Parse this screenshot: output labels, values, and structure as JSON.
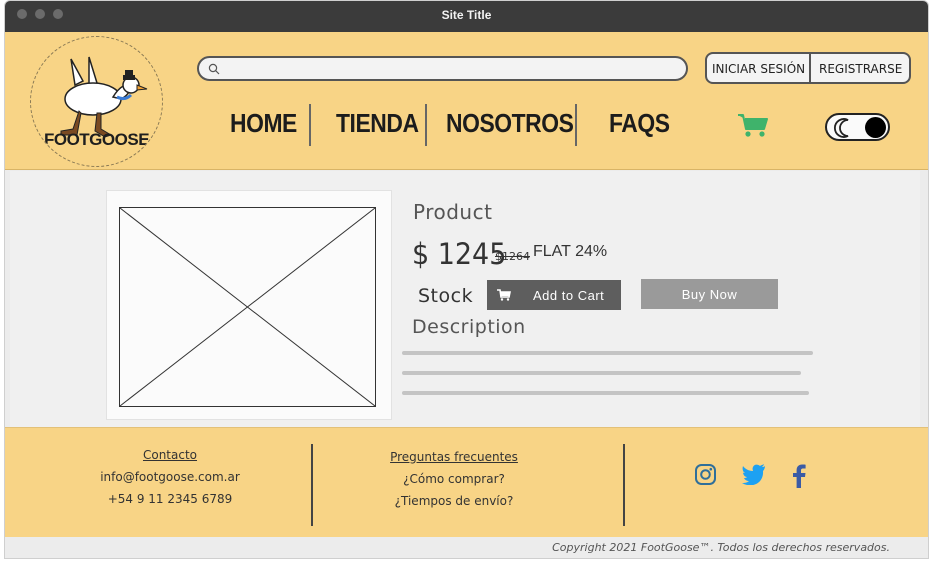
{
  "window": {
    "title": "Site Title"
  },
  "header": {
    "logo_text": "FOOTGOOSE",
    "search": {
      "placeholder": "",
      "value": ""
    },
    "auth": {
      "login_label": "INICIAR SESIÓN",
      "register_label": "REGISTRARSE"
    },
    "nav": [
      {
        "label": "HOME"
      },
      {
        "label": "TIENDA"
      },
      {
        "label": "NOSOTROS"
      },
      {
        "label": "FAQS"
      }
    ],
    "cart_icon": "shopping-cart-icon",
    "theme_toggle": {
      "icon": "moon-icon",
      "state": "dark"
    }
  },
  "product": {
    "title": "Product",
    "price": "$ 1245",
    "old_price": "$1264",
    "discount": "FLAT 24%",
    "stock_label": "Stock",
    "add_to_cart_label": "Add to Cart",
    "buy_now_label": "Buy Now",
    "description_label": "Description"
  },
  "footer": {
    "contact": {
      "heading": "Contacto",
      "email": "info@footgoose.com.ar",
      "phone": "+54 9 11 2345 6789"
    },
    "faq": {
      "heading": "Preguntas frecuentes",
      "items": [
        "¿Cómo comprar?",
        "¿Tiempos de envío?"
      ]
    },
    "social": [
      "instagram-icon",
      "twitter-icon",
      "facebook-icon"
    ],
    "copyright": "Copyright 2021 FootGoose™. Todos los derechos reservados."
  },
  "colors": {
    "header_bg": "#f8d486",
    "cart_icon": "#3fb36b",
    "instagram": "#2f6f9a",
    "twitter": "#1da1f2",
    "facebook": "#3b5ba5"
  }
}
